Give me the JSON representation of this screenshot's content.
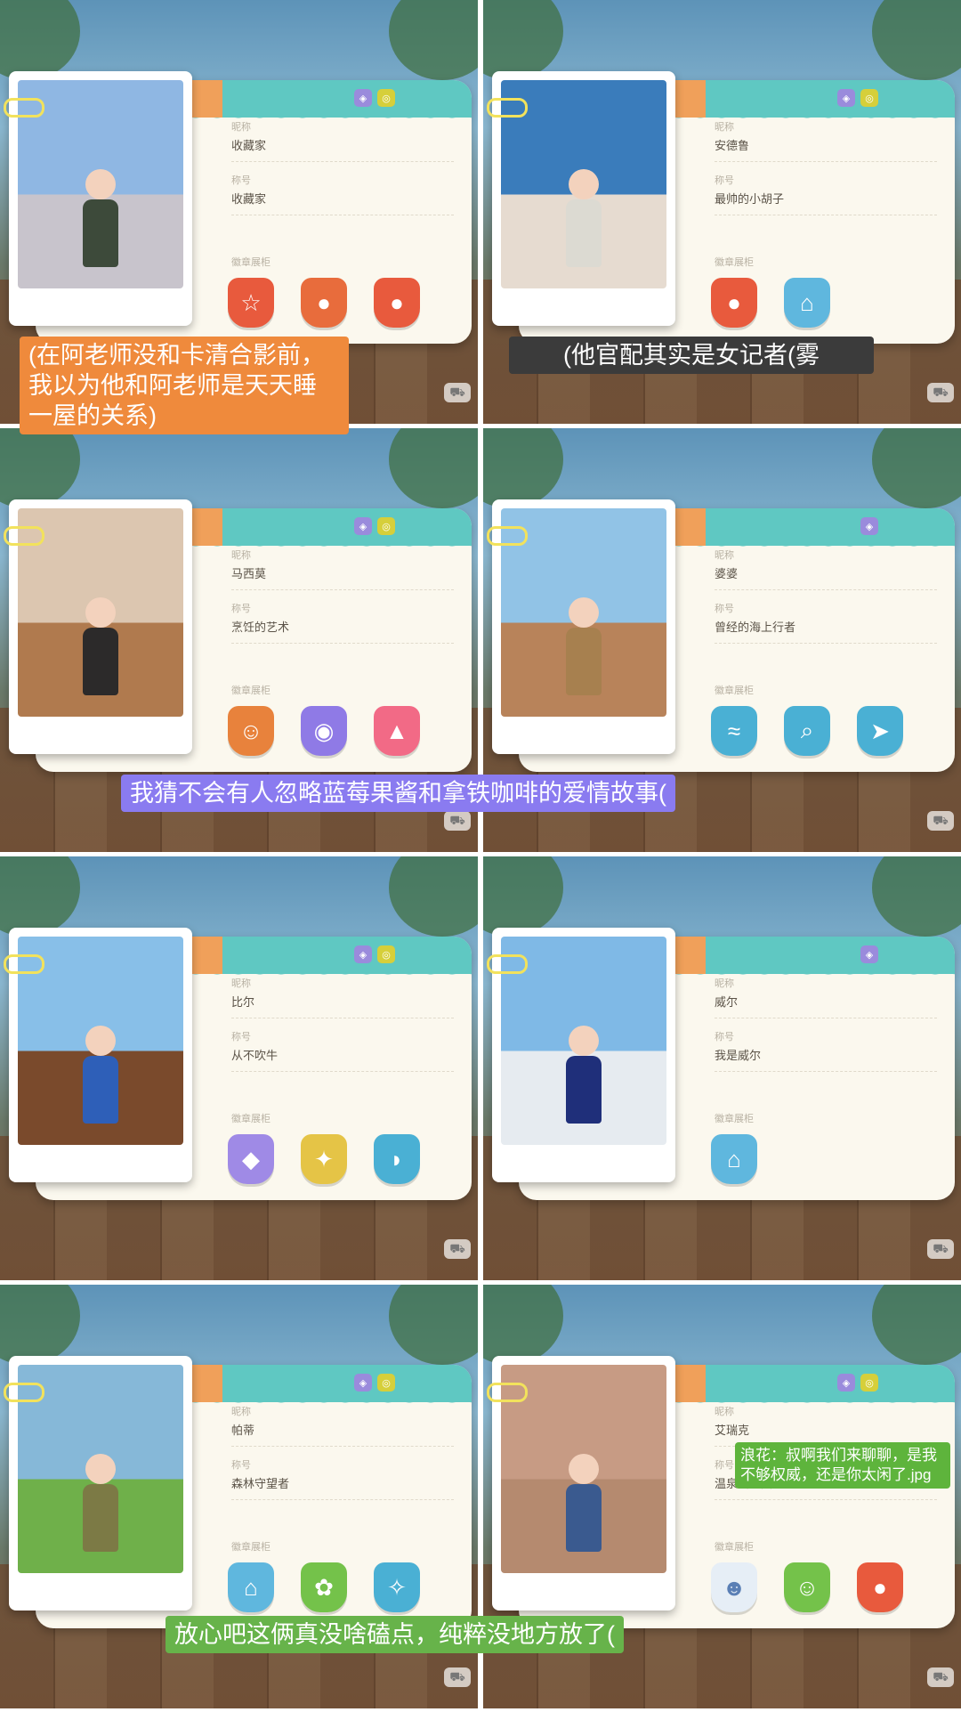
{
  "labels": {
    "nickname": "昵称",
    "title": "称号",
    "badges": "徽章展柜"
  },
  "cards": [
    {
      "nickname": "收藏家",
      "title": "收藏家",
      "badges": [
        "star-badge",
        "coin-badge",
        "coin-badge"
      ],
      "badge_colors": [
        "#e85a3d",
        "#e86c3c",
        "#e85a3d"
      ],
      "mini": [
        "purple",
        "yellow"
      ],
      "photo": "collector-portrait",
      "sky": "#8fb7e3",
      "ground": "#c8c4cc",
      "outfit": "#3d4a3a"
    },
    {
      "nickname": "安德鲁",
      "title": "最帅的小胡子",
      "badges": [
        "coin-badge",
        "house-badge"
      ],
      "badge_colors": [
        "#e85a3d",
        "#5fb7de"
      ],
      "mini": [
        "purple",
        "yellow"
      ],
      "photo": "car-on-beach",
      "sky": "#3a7cbb",
      "ground": "#e6dbd0",
      "outfit": "#dcdad2"
    },
    {
      "nickname": "马西莫",
      "title": "烹饪的艺术",
      "badges": [
        "chef-badge",
        "pancake-badge",
        "cake-badge"
      ],
      "badge_colors": [
        "#e8823c",
        "#8f7ae6",
        "#f26a86"
      ],
      "mini": [
        "purple",
        "yellow"
      ],
      "photo": "chef-portrait",
      "sky": "#dcc6b0",
      "ground": "#b07a4e",
      "outfit": "#2c2a2a"
    },
    {
      "nickname": "婆婆",
      "title": "曾经的海上行者",
      "badges": [
        "shrimp-badge",
        "fish-search-badge",
        "fish-badge"
      ],
      "badge_colors": [
        "#4ab0d4",
        "#4ab0d4",
        "#4ab0d4"
      ],
      "mini": [
        "purple"
      ],
      "photo": "grandma-portrait",
      "sky": "#91c3e6",
      "ground": "#b8835a",
      "outfit": "#a7804f"
    },
    {
      "nickname": "比尔",
      "title": "从不吹牛",
      "badges": [
        "tuna-badge",
        "wheat-badge",
        "whale-badge"
      ],
      "badge_colors": [
        "#9f8ae6",
        "#e5c446",
        "#4ab0d4"
      ],
      "mini": [
        "purple",
        "yellow"
      ],
      "photo": "bill-portrait",
      "sky": "#88bfe8",
      "ground": "#7a4a2c",
      "outfit": "#2e5fb8"
    },
    {
      "nickname": "威尔",
      "title": "我是威尔",
      "badges": [
        "house-badge"
      ],
      "badge_colors": [
        "#5fb7de"
      ],
      "mini": [
        "purple"
      ],
      "photo": "will-portrait",
      "sky": "#7fb9e6",
      "ground": "#e6ebf0",
      "outfit": "#1f2f7a"
    },
    {
      "nickname": "帕蒂",
      "title": "森林守望者",
      "badges": [
        "house-badge",
        "butterfly-badge",
        "bird-badge"
      ],
      "badge_colors": [
        "#5fb7de",
        "#74c24a",
        "#4ab0d4"
      ],
      "mini": [
        "purple",
        "yellow"
      ],
      "photo": "forest-ranger-portrait",
      "sky": "#86b8d8",
      "ground": "#6fb04a",
      "outfit": "#7c7a45"
    },
    {
      "nickname": "艾瑞克",
      "title": "温泉山乐园经理",
      "badges": [
        "people-badge",
        "guide-badge",
        "coin-badge"
      ],
      "badge_colors": [
        "#e6eef6",
        "#74c24a",
        "#e85a3d"
      ],
      "mini": [
        "purple",
        "yellow"
      ],
      "photo": "eric-portrait",
      "sky": "#c79b84",
      "ground": "#b58a6f",
      "outfit": "#3a5a8f"
    }
  ],
  "captions": {
    "cap1": "(在阿老师没和卡清合影前，我以为他和阿老师是天天睡一屋的关系)",
    "cap2": "(他官配其实是女记者(雾",
    "cap3": "我猜不会有人忽略蓝莓果酱和拿铁咖啡的爱情故事(",
    "cap4": "浪花：叔啊我们来聊聊，是我不够权威，还是你太闲了.jpg",
    "cap5": "放心吧这俩真没啥磕点，纯粹没地方放了("
  }
}
